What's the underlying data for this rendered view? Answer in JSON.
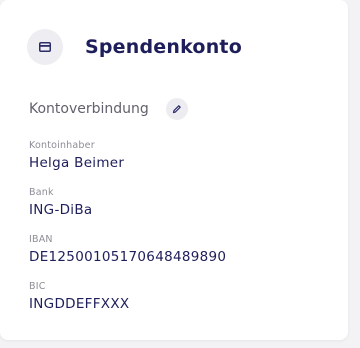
{
  "card": {
    "icon": "credit-card-icon",
    "title": "Spendenkonto"
  },
  "section": {
    "title": "Kontoverbindung",
    "edit_icon": "pencil-icon"
  },
  "fields": [
    {
      "label": "Kontoinhaber",
      "value": "Helga Beimer"
    },
    {
      "label": "Bank",
      "value": "ING-DiBa"
    },
    {
      "label": "IBAN",
      "value": "DE12500105170648489890"
    },
    {
      "label": "BIC",
      "value": "INGDDEFFXXX"
    }
  ],
  "colors": {
    "accent": "#1e1e5a",
    "muted": "#8d8d97",
    "icon_bg": "#ededf2"
  }
}
